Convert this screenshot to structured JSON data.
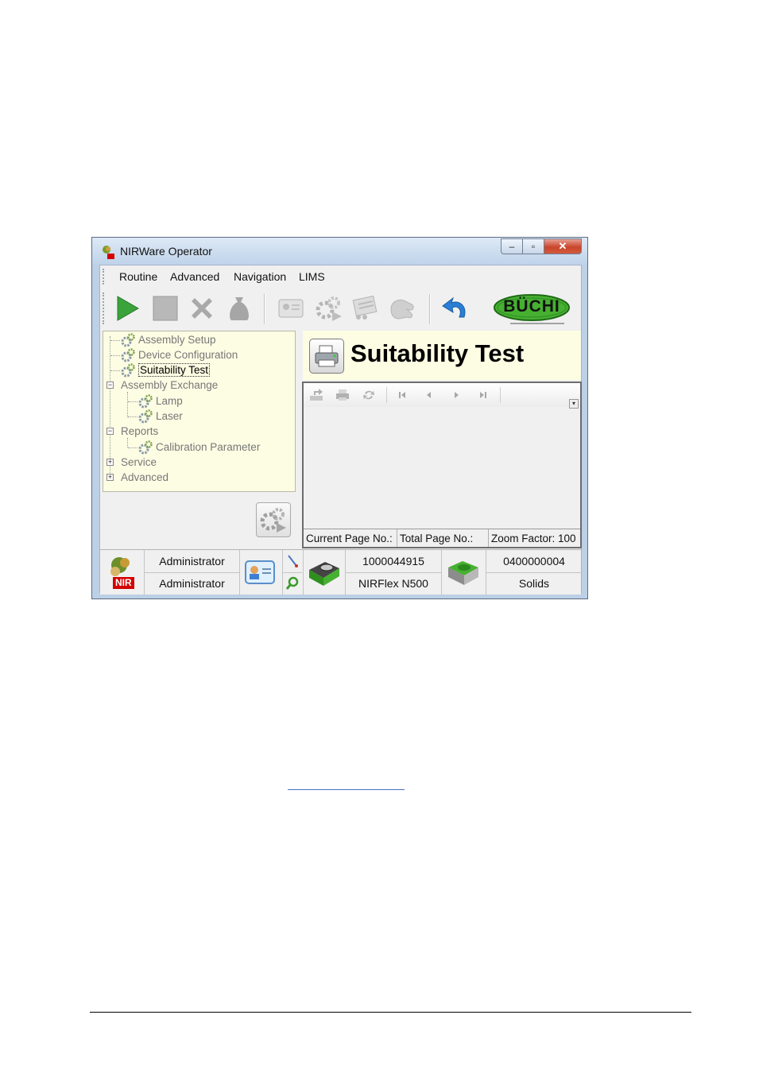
{
  "window": {
    "title": "NIRWare Operator",
    "controls": {
      "minimize": "–",
      "maximize": "▫",
      "close": "✕"
    }
  },
  "menu": {
    "items": [
      "Routine",
      "Advanced",
      "Navigation",
      "LIMS"
    ]
  },
  "toolbar": {
    "icons": [
      "play-icon",
      "stop-icon",
      "cancel-x-icon",
      "sample-bag-icon",
      "id-card-icon",
      "gear-run-icon",
      "report-icon",
      "hand-icon",
      "undo-arrow-icon"
    ],
    "logo_text": "BÜCHI",
    "colors": {
      "play": "#3aa33a",
      "logo_green": "#46b031",
      "undo": "#2a7fd4"
    }
  },
  "tree": {
    "items": [
      {
        "label": "Assembly Setup"
      },
      {
        "label": "Device Configuration"
      },
      {
        "label": "Suitability Test"
      },
      {
        "label": "Assembly Exchange",
        "expander": "−"
      },
      {
        "label": "Lamp"
      },
      {
        "label": "Laser"
      },
      {
        "label": "Reports",
        "expander": "−"
      },
      {
        "label": "Calibration Parameter"
      },
      {
        "label": "Service",
        "expander": "+"
      },
      {
        "label": "Advanced",
        "expander": "+"
      }
    ],
    "selected": "Suitability Test",
    "background": "#fdfde4"
  },
  "main": {
    "title": "Suitability Test"
  },
  "report_viewer": {
    "toolbar_icons": [
      "export-icon",
      "print-icon",
      "refresh-icon",
      "first-page-icon",
      "previous-page-icon",
      "next-page-icon",
      "last-page-icon"
    ],
    "status": {
      "current_page": "Current Page No.:",
      "total_page": "Total Page No.:",
      "zoom": "Zoom Factor: 100"
    }
  },
  "statusbar": {
    "user_top": "Administrator",
    "user_bottom": "Administrator",
    "instrument_serial": "1000044915",
    "instrument_model": "NIRFlex N500",
    "cell_serial": "0400000004",
    "cell_type": "Solids",
    "nir_label": "NIR"
  }
}
